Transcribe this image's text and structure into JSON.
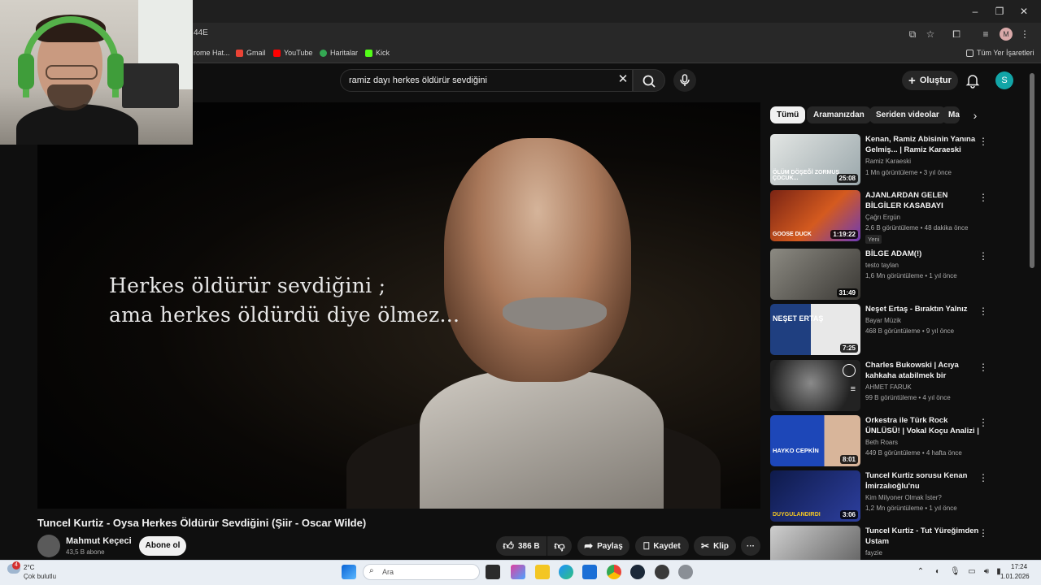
{
  "browser": {
    "url_fragment": "44E",
    "bookmarks": [
      {
        "label": "rome Hat...",
        "color": "#7a7a7a"
      },
      {
        "label": "Gmail",
        "color": "#ea4335"
      },
      {
        "label": "YouTube",
        "color": "#ff0000"
      },
      {
        "label": "Haritalar",
        "color": "#34a853"
      },
      {
        "label": "Kick",
        "color": "#53fc18"
      }
    ],
    "all_bookmarks": "Tüm Yer İşaretleri",
    "profile_initial": "M",
    "window_controls": [
      "–",
      "❐",
      "✕"
    ]
  },
  "youtube": {
    "search_query": "ramiz dayı herkes öldürür sevdiğini",
    "create_label": "Oluştur",
    "avatar_initial": "S"
  },
  "video": {
    "overlay_line1": "Herkes öldürür sevdiğini ;",
    "overlay_line2": "ama herkes öldürdü diye ölmez...",
    "title": "Tuncel Kurtiz - Oysa Herkes Öldürür Sevdiğini (Şiir - Oscar Wilde)",
    "channel": "Mahmut Keçeci",
    "subscribers": "43,5 B abone",
    "subscribe_label": "Abone ol",
    "likes": "386 B",
    "share_label": "Paylaş",
    "save_label": "Kaydet",
    "clip_label": "Klip"
  },
  "chips": [
    "Tümü",
    "Aramanızdan",
    "Seriden videolar",
    "Ma"
  ],
  "recommendations": [
    {
      "title": "Kenan, Ramiz Abisinin Yanına Gelmiş... | Ramiz Karaeski",
      "channel": "Ramiz Karaeski",
      "meta": "1 Mn görüntüleme • 3 yıl önce",
      "duration": "25:08",
      "caption": "ÖLÜM DÖŞEĞİ ZORMUŞ ÇOCUK...",
      "thumb": "#b8c4c8"
    },
    {
      "title": "AJANLARDAN GELEN BİLGİLER KASABAYI TEHLİKEYE SOKTU!...",
      "channel": "Çağrı Ergün",
      "meta": "2,6 B görüntüleme • 48 dakika önce",
      "duration": "1:19:22",
      "badge": "Yeni",
      "caption": "GOOSE DUCK",
      "thumb": "#c9501e"
    },
    {
      "title": "BİLGE ADAM(!)",
      "channel": "testo taylan",
      "meta": "1,6 Mn görüntüleme • 1 yıl önce",
      "duration": "31:49",
      "thumb": "#6b6a66"
    },
    {
      "title": "Neşet Ertaş - Bıraktın Yalnız",
      "channel": "Bayar Müzik",
      "meta": "468 B görüntüleme • 9 yıl önce",
      "duration": "7:25",
      "caption": "NEŞET ERTAŞ",
      "thumb": "#2b4f8f"
    },
    {
      "title": "Charles Bukowski | Acıya kahkaha atabilmek bir sanatsa...",
      "channel": "AHMET FARUK",
      "meta": "99 B görüntüleme • 4 yıl önce",
      "thumb": "#3c3c3c"
    },
    {
      "title": "Orkestra ile Türk Rock ÜNLÜSÜ! | Vokal Koçu Analizi | Hayko ...",
      "channel": "Beth Roars",
      "meta": "449 B görüntüleme • 4 hafta önce",
      "duration": "8:01",
      "caption": "HAYKO CEPKİN",
      "thumb": "#1d47b8"
    },
    {
      "title": "Tuncel Kurtiz sorusu Kenan İmirzalıoğlu'nu duygulandırıyor...",
      "channel": "Kim Milyoner Olmak İster?",
      "meta": "1,2 Mn görüntüleme • 1 yıl önce",
      "duration": "3:06",
      "caption": "DUYGULANDIRDI",
      "thumb": "#1a2a6c"
    },
    {
      "title": "Tuncel Kurtiz - Tut Yüreğimden Ustam",
      "channel": "fayzie",
      "meta": "",
      "thumb": "#8a8a8a"
    }
  ],
  "taskbar": {
    "weather_badge": "4",
    "temperature": "2°C",
    "weather": "Çok bulutlu",
    "search_placeholder": "Ara",
    "time": "17:24",
    "date": "1.01.2026"
  }
}
